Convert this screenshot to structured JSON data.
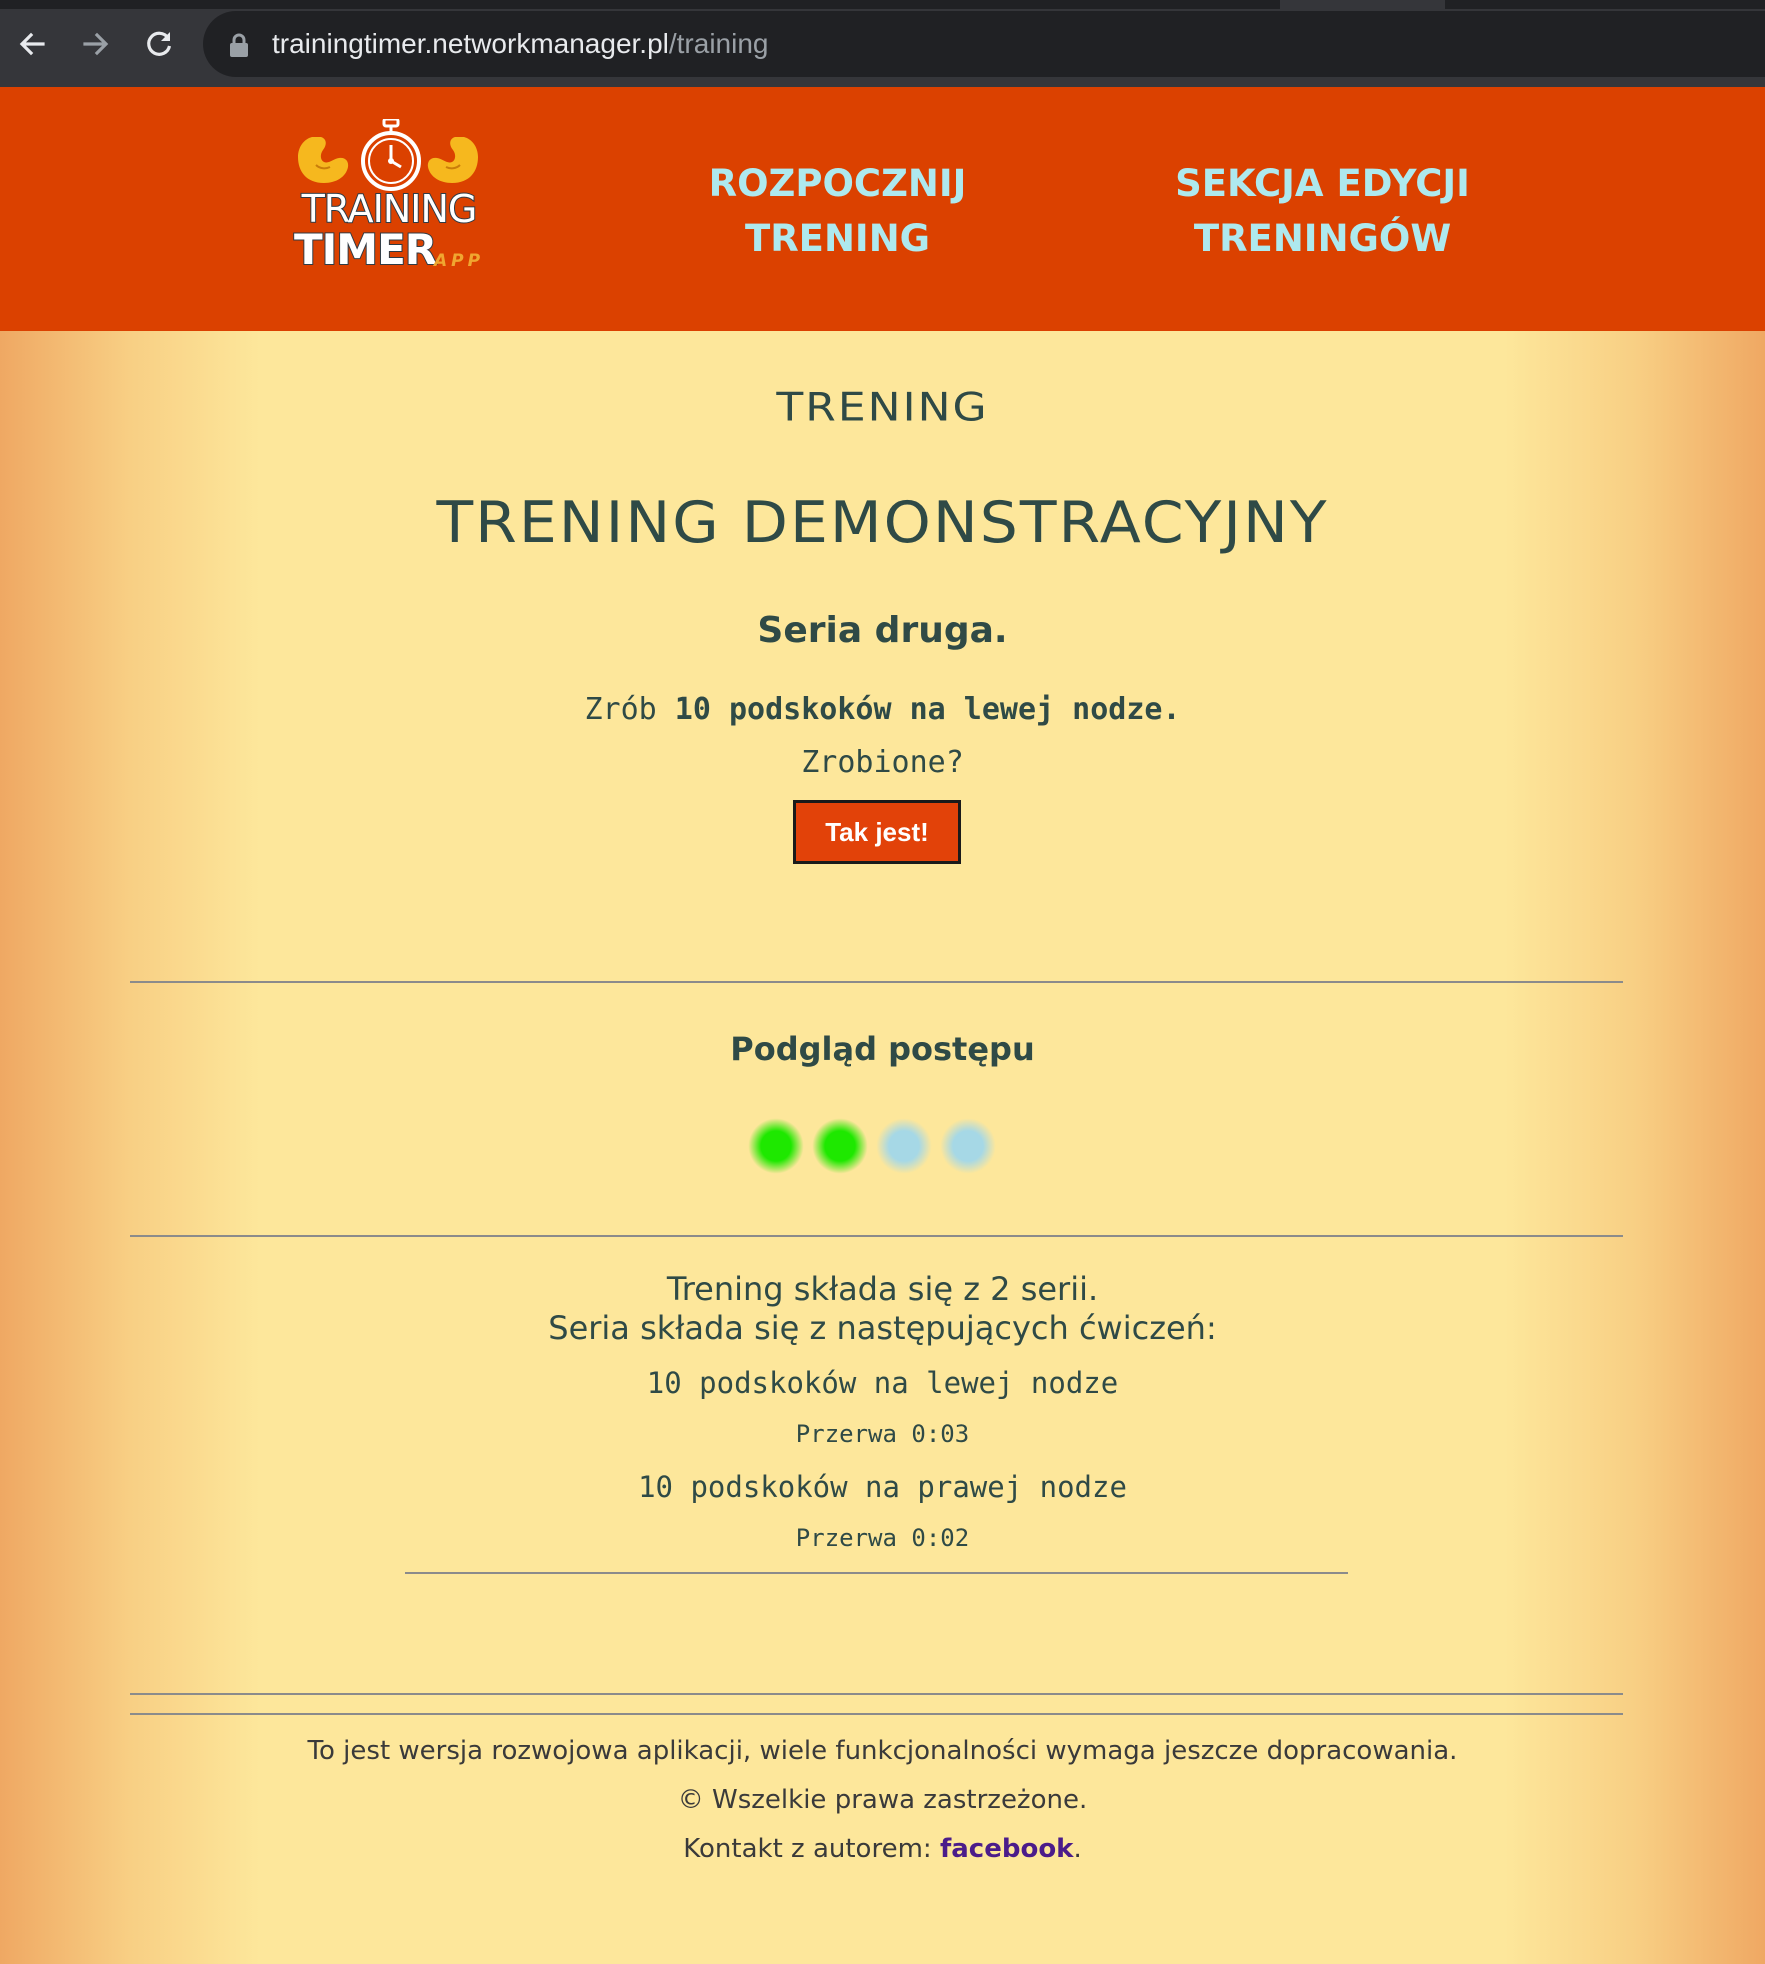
{
  "browser": {
    "url_host": "trainingtimer.networkmanager.pl",
    "url_path": "/training"
  },
  "header": {
    "logo": {
      "line1": "TRAINING",
      "line2": "TIMER",
      "suffix": "APP"
    },
    "nav": [
      {
        "label": "ROZPOCZNIJ TRENING"
      },
      {
        "label": "SEKCJA EDYCJI TRENINGÓW"
      }
    ]
  },
  "main": {
    "section_title": "TRENING",
    "training_name": "TRENING DEMONSTRACYJNY",
    "series_label": "Seria druga.",
    "instruction_prefix": "Zrób",
    "instruction_exercise": "10 podskoków na lewej nodze.",
    "done_question": "Zrobione?",
    "confirm_button": "Tak jest!"
  },
  "progress": {
    "title": "Podgląd postępu",
    "steps_total": 4,
    "steps_done": 2,
    "done_color": "#1ee800",
    "pending_color": "#a6d8e6"
  },
  "summary": {
    "series_count_text": "Trening składa się z 2 serii.",
    "exercises_intro": "Seria składa się z następujących ćwiczeń:",
    "items": [
      {
        "exercise": "10 podskoków na lewej nodze",
        "break": "Przerwa 0:03"
      },
      {
        "exercise": "10 podskoków na prawej nodze",
        "break": "Przerwa 0:02"
      }
    ]
  },
  "footer": {
    "dev_notice": "To jest wersja rozwojowa aplikacji, wiele funkcjonalności wymaga jeszcze dopracowania.",
    "copyright": "© Wszelkie prawa zastrzeżone.",
    "contact_prefix": "Kontakt z autorem: ",
    "contact_link": "facebook",
    "contact_suffix": "."
  },
  "colors": {
    "header_bg": "#db4100",
    "nav_text": "#aee9ee",
    "page_bg": "#fde79b",
    "heading_text": "#2f4a46",
    "button_bg": "#e24209"
  }
}
